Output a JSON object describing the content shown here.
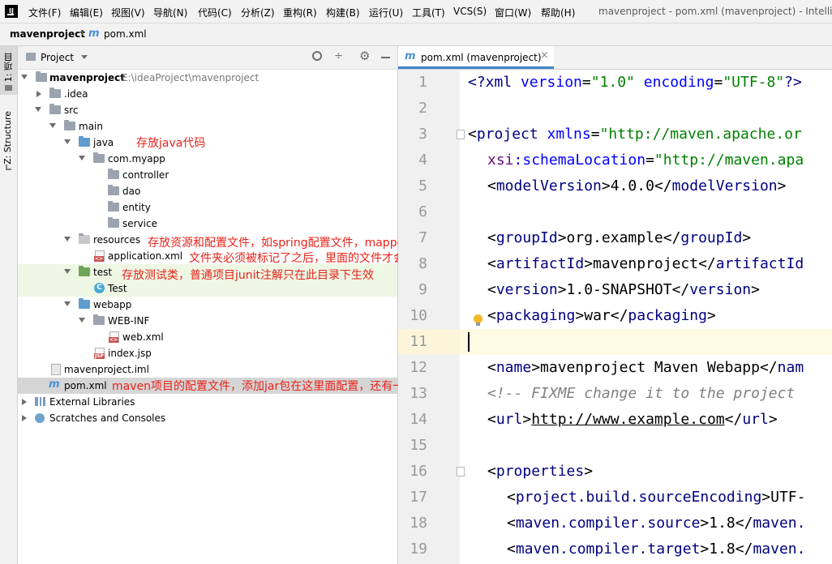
{
  "menu": {
    "items": [
      "文件(F)",
      "编辑(E)",
      "视图(V)",
      "导航(N)",
      "代码(C)",
      "分析(Z)",
      "重构(R)",
      "构建(B)",
      "运行(U)",
      "工具(T)",
      "VCS(S)",
      "窗口(W)",
      "帮助(H)"
    ],
    "window_title": "mavenproject - pom.xml (mavenproject) - IntelliJ"
  },
  "breadcrumb": {
    "project": "mavenproject",
    "file": "pom.xml"
  },
  "left_strip": {
    "project_tab": "1: 项目",
    "structure_tab": "Z: Structure"
  },
  "project_panel": {
    "title": "Project",
    "tree": [
      {
        "label": "mavenproject",
        "path": "E:\\ideaProject\\mavenproject",
        "icon": "folder-icon"
      },
      {
        "label": ".idea",
        "icon": "folder-icon"
      },
      {
        "label": "src",
        "icon": "folder-icon"
      },
      {
        "label": "main",
        "icon": "folder-icon"
      },
      {
        "label": "java",
        "icon": "source-folder-icon"
      },
      {
        "label": "com.myapp",
        "icon": "package-icon"
      },
      {
        "label": "controller",
        "icon": "package-icon"
      },
      {
        "label": "dao",
        "icon": "package-icon"
      },
      {
        "label": "entity",
        "icon": "package-icon"
      },
      {
        "label": "service",
        "icon": "package-icon"
      },
      {
        "label": "resources",
        "icon": "resources-folder-icon"
      },
      {
        "label": "application.xml",
        "icon": "xml-file-icon"
      },
      {
        "label": "test",
        "icon": "test-folder-icon"
      },
      {
        "label": "Test",
        "icon": "class-icon"
      },
      {
        "label": "webapp",
        "icon": "web-folder-icon"
      },
      {
        "label": "WEB-INF",
        "icon": "folder-icon"
      },
      {
        "label": "web.xml",
        "icon": "xml-file-icon"
      },
      {
        "label": "index.jsp",
        "icon": "jsp-file-icon"
      },
      {
        "label": "mavenproject.iml",
        "icon": "iml-file-icon"
      },
      {
        "label": "pom.xml",
        "icon": "maven-icon"
      },
      {
        "label": "External Libraries",
        "icon": "library-icon"
      },
      {
        "label": "Scratches and Consoles",
        "icon": "scratches-icon"
      }
    ],
    "annotations": {
      "java": "存放java代码",
      "resources": "存放资源和配置文件，如spring配置文件，mapper文件等",
      "resources_note": "文件夹必须被标记了之后，里面的文件才会被打包",
      "test": "存放测试类，普通项目junit注解只在此目录下生效",
      "pom": "maven项目的配置文件，添加jar包在这里面配置，还有一些其他配置"
    }
  },
  "editor": {
    "tab_label": "pom.xml (mavenproject)",
    "line_numbers": [
      "1",
      "2",
      "3",
      "4",
      "5",
      "6",
      "7",
      "8",
      "9",
      "10",
      "11",
      "12",
      "13",
      "14",
      "15",
      "16",
      "17",
      "18",
      "19"
    ],
    "code": {
      "l1": {
        "a": "<?xml ",
        "b": "version",
        "c": "=",
        "d": "\"1.0\"",
        "e": " ",
        "f": "encoding",
        "g": "=",
        "h": "\"UTF-8\"",
        "i": "?>"
      },
      "l3": {
        "a": "<",
        "b": "project ",
        "c": "xmlns",
        "d": "=",
        "e": "\"http://maven.apache.or"
      },
      "l4": {
        "a": "xsi",
        "b": ":schemaLocation",
        "c": "=",
        "d": "\"http://maven.apa"
      },
      "l5": {
        "a": "<",
        "b": "modelVersion",
        "c": ">4.0.0</",
        "d": "modelVersion",
        "e": ">"
      },
      "l7": {
        "a": "<",
        "b": "groupId",
        "c": ">org.example</",
        "d": "groupId",
        "e": ">"
      },
      "l8": {
        "a": "<",
        "b": "artifactId",
        "c": ">mavenproject</",
        "d": "artifactId"
      },
      "l9": {
        "a": "<",
        "b": "version",
        "c": ">1.0-SNAPSHOT</",
        "d": "version",
        "e": ">"
      },
      "l10": {
        "a": "<",
        "b": "packaging",
        "c": ">war</",
        "d": "packaging",
        "e": ">"
      },
      "l12": {
        "a": "<",
        "b": "name",
        "c": ">mavenproject Maven Webapp</",
        "d": "nam"
      },
      "l13": {
        "a": "<!-- FIXME change it to the project"
      },
      "l14": {
        "a": "<",
        "b": "url",
        "c": ">",
        "d": "http://www.example.com",
        "e": "</",
        "f": "url",
        "g": ">"
      },
      "l16": {
        "a": "<",
        "b": "properties",
        "c": ">"
      },
      "l17": {
        "a": "<",
        "b": "project.build.sourceEncoding",
        "c": ">UTF-"
      },
      "l18": {
        "a": "<",
        "b": "maven.compiler.source",
        "c": ">1.8</",
        "d": "maven."
      },
      "l19": {
        "a": "<",
        "b": "maven.compiler.target",
        "c": ">1.8</",
        "d": "maven."
      }
    }
  }
}
